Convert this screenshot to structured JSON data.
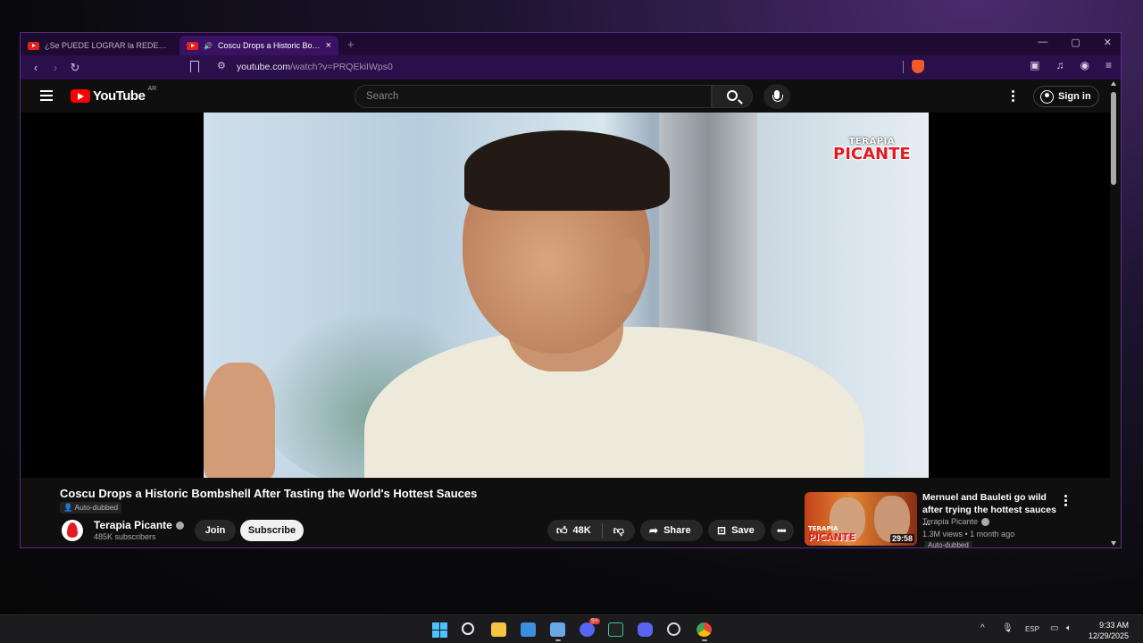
{
  "browser": {
    "tabs": [
      {
        "title": "¿Se PUEDE LOGRAR la REDENCIÓN?",
        "active": false
      },
      {
        "title": "Coscu Drops a Historic Bombshell",
        "active": true,
        "close": "×"
      }
    ],
    "new_tab": "+",
    "window_controls": {
      "minimize": "—",
      "maximize": "▢",
      "close": "✕"
    },
    "url_host": "youtube.com",
    "url_path": "/watch?v=PRQEkiIWps0"
  },
  "youtube": {
    "logo_text": "YouTube",
    "region": "AR",
    "search_placeholder": "Search",
    "sign_in": "Sign in"
  },
  "video": {
    "overlay_brand_line1": "TERAPIA",
    "overlay_brand_line2": "PICANTE",
    "title": "Coscu Drops a Historic Bombshell After Tasting the World's Hottest Sauces",
    "auto_dubbed": "Auto-dubbed",
    "channel_name": "Terapia Picante",
    "subscribers": "485K subscribers",
    "join": "Join",
    "subscribe": "Subscribe",
    "likes": "48K",
    "share": "Share",
    "save": "Save"
  },
  "recommended": {
    "title": "Mernuel and Bauleti go wild after trying the hottest sauces ...",
    "channel": "Terapia Picante",
    "meta": "1.3M views • 1 month ago",
    "duration": "29:58",
    "thumb_label_small": "TERAPIA",
    "thumb_label": "PICANTE",
    "auto_dubbed": "Auto-dubbed"
  },
  "taskbar": {
    "language": "ESP",
    "time": "9:33 AM",
    "date": "12/29/2025",
    "badge": "9+"
  }
}
